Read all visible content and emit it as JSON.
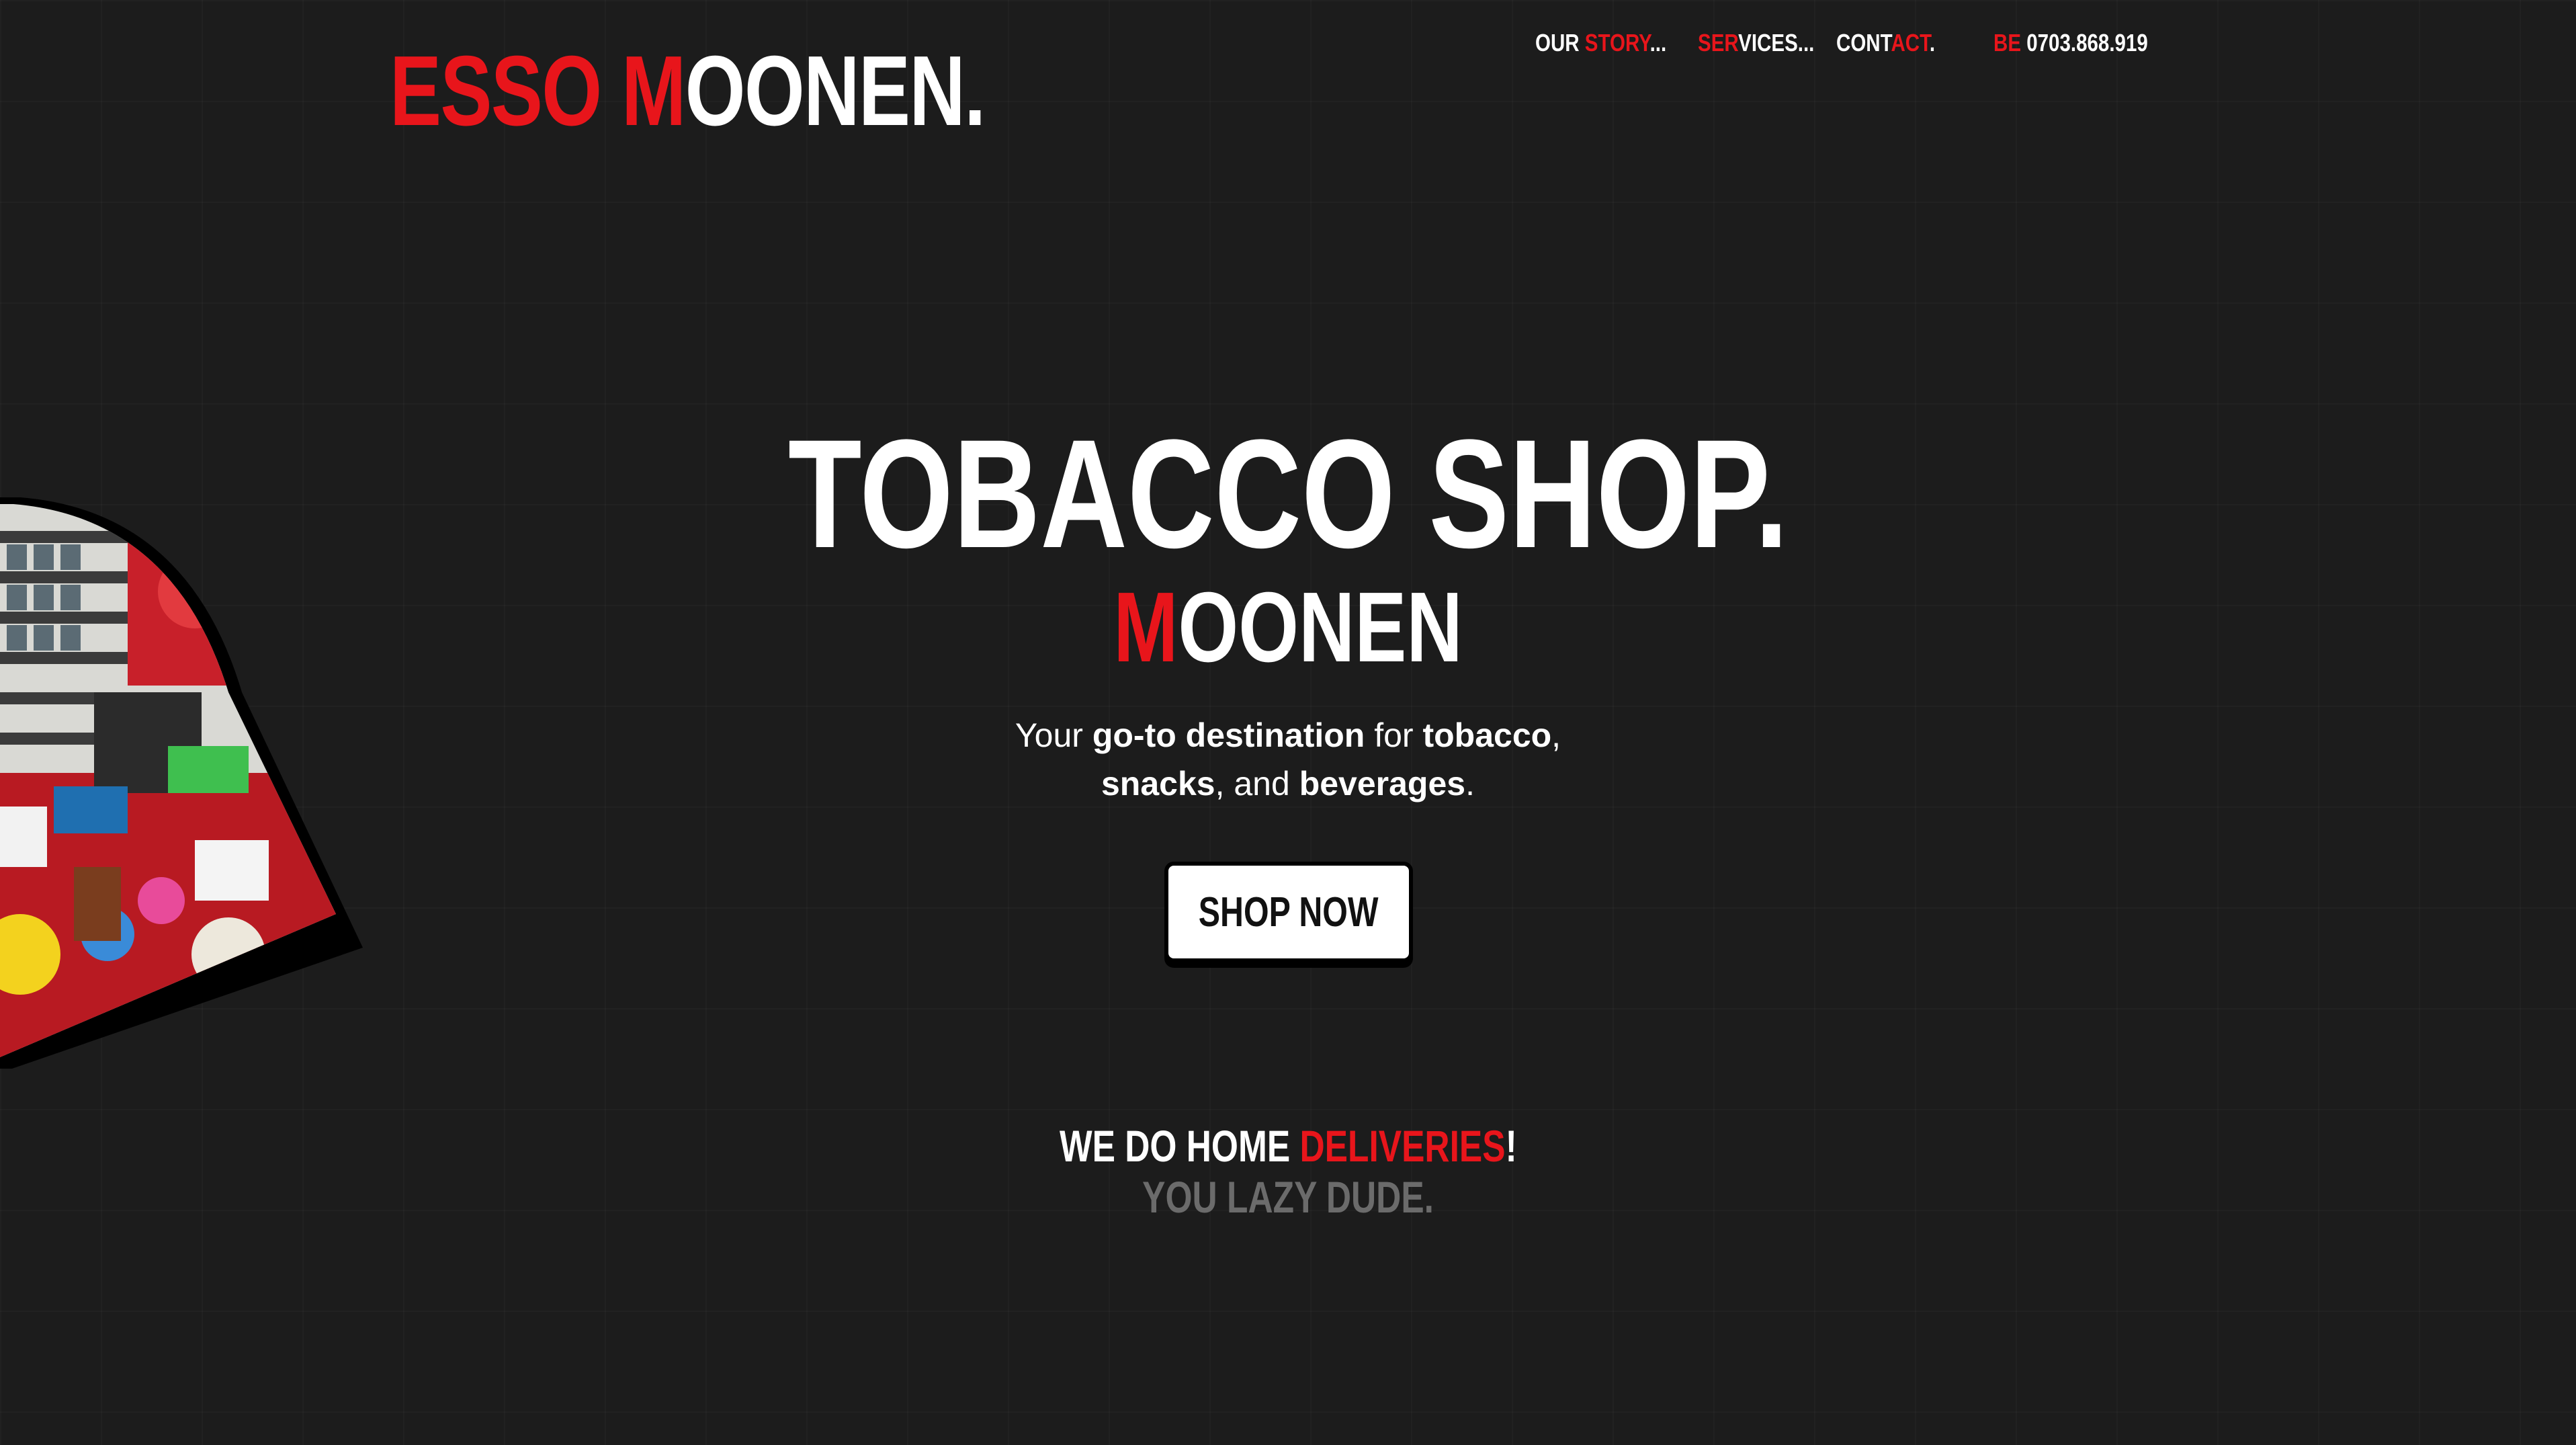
{
  "brand": {
    "part1": "ESSO ",
    "part2_red": "M",
    "part3": "OONEN."
  },
  "nav": {
    "story": {
      "white": "OUR ",
      "red": "STORY",
      "tail": "..."
    },
    "services": {
      "red": "SER",
      "white": "VICES..."
    },
    "contact": {
      "white": "CONT",
      "red": "ACT",
      "tail": "."
    },
    "phone": {
      "red": "BE ",
      "number": "0703.868.919"
    }
  },
  "photo": {
    "alt_icon": "shop-interior-photo"
  },
  "hero": {
    "title": "TOBACCO SHOP.",
    "subtitle_red": "M",
    "subtitle_rest": "OONEN",
    "desc_1": "Your ",
    "desc_b1": "go-to destination",
    "desc_2": " for ",
    "desc_b2": "tobacco",
    "desc_3": ",",
    "desc_b3": "snacks",
    "desc_4": ", and ",
    "desc_b4": "beverages",
    "desc_5": "."
  },
  "cta": {
    "shop_now": "SHOP NOW"
  },
  "delivery": {
    "white": "WE DO HOME ",
    "red": "DELIVERIES",
    "tail": "!",
    "lazy": "YOU LAZY DUDE."
  },
  "colors": {
    "accent": "#e8151b",
    "background": "#1c1c1c",
    "muted": "#6b6b6b"
  }
}
